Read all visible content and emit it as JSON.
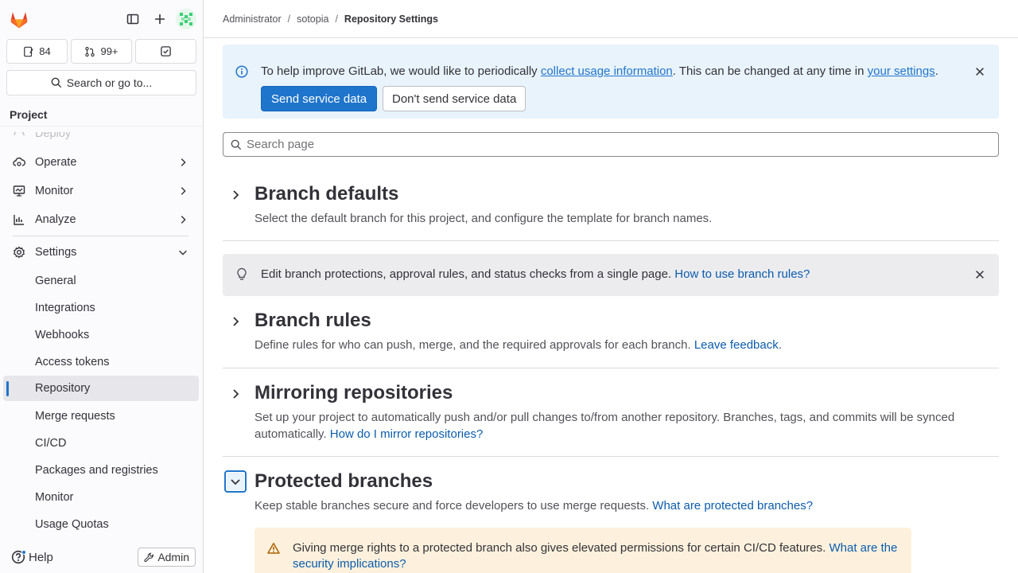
{
  "sidebar": {
    "counts": {
      "issues": "84",
      "merge_requests": "99+"
    },
    "search_label": "Search or go to...",
    "section_title": "Project",
    "nav_items": [
      {
        "label": "Deploy"
      },
      {
        "label": "Operate"
      },
      {
        "label": "Monitor"
      },
      {
        "label": "Analyze"
      },
      {
        "label": "Settings"
      }
    ],
    "settings_items": [
      {
        "label": "General"
      },
      {
        "label": "Integrations"
      },
      {
        "label": "Webhooks"
      },
      {
        "label": "Access tokens"
      },
      {
        "label": "Repository",
        "active": true
      },
      {
        "label": "Merge requests"
      },
      {
        "label": "CI/CD"
      },
      {
        "label": "Packages and registries"
      },
      {
        "label": "Monitor"
      },
      {
        "label": "Usage Quotas"
      }
    ],
    "help_label": "Help",
    "admin_label": "Admin"
  },
  "breadcrumb": [
    {
      "label": "Administrator"
    },
    {
      "label": "sotopia"
    },
    {
      "label": "Repository Settings"
    }
  ],
  "banner": {
    "text_before": "To help improve GitLab, we would like to periodically ",
    "link1": "collect usage information",
    "text_middle": ". This can be changed at any time in ",
    "link2": "your settings",
    "text_after": ".",
    "primary_button": "Send service data",
    "secondary_button": "Don't send service data"
  },
  "search_page": {
    "placeholder": "Search page"
  },
  "sections": {
    "branch_defaults": {
      "title": "Branch defaults",
      "description": "Select the default branch for this project, and configure the template for branch names."
    },
    "tip": {
      "text": "Edit branch protections, approval rules, and status checks from a single page. ",
      "link": "How to use branch rules?"
    },
    "branch_rules": {
      "title": "Branch rules",
      "description": "Define rules for who can push, merge, and the required approvals for each branch. ",
      "link": "Leave feedback",
      "after": "."
    },
    "mirroring": {
      "title": "Mirroring repositories",
      "description": "Set up your project to automatically push and/or pull changes to/from another repository. Branches, tags, and commits will be synced automatically. ",
      "link": "How do I mirror repositories?"
    },
    "protected_branches": {
      "title": "Protected branches",
      "description": "Keep stable branches secure and force developers to use merge requests. ",
      "link": "What are protected branches?"
    },
    "warning": {
      "text": "Giving merge rights to a protected branch also gives elevated permissions for certain CI/CD features. ",
      "link": "What are the security implications?"
    }
  },
  "colors": {
    "accent": "#1f75cb",
    "banner_bg": "#e9f3fc",
    "warning_bg": "#fdf1dd"
  }
}
